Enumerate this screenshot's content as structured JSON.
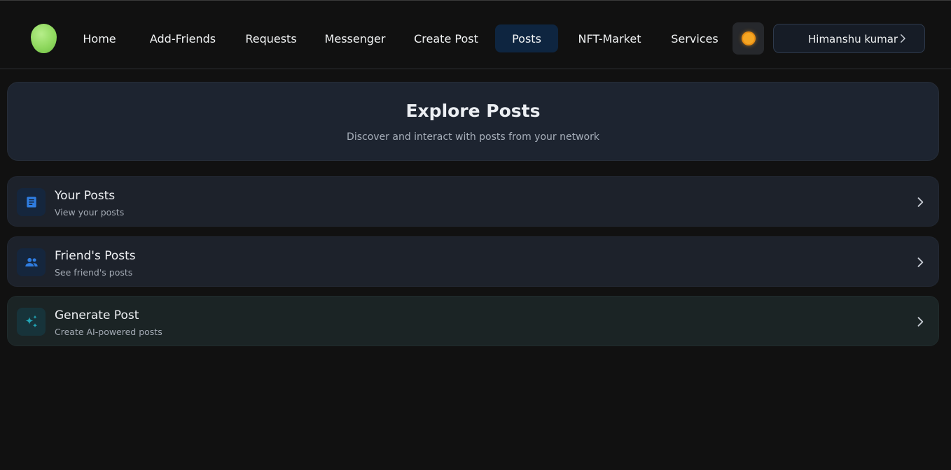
{
  "nav": {
    "items": [
      {
        "label": "Home",
        "active": false
      },
      {
        "label": "Add-Friends",
        "active": false
      },
      {
        "label": "Requests",
        "active": false
      },
      {
        "label": "Messenger",
        "active": false
      },
      {
        "label": "Create Post",
        "active": false
      },
      {
        "label": "Posts",
        "active": true
      },
      {
        "label": "NFT-Market",
        "active": false
      },
      {
        "label": "Services",
        "active": false
      }
    ],
    "theme_icon": "sun-icon",
    "user_name": "Himanshu kumar"
  },
  "hero": {
    "title": "Explore Posts",
    "subtitle": "Discover and interact with posts from your network"
  },
  "cards": [
    {
      "title": "Your Posts",
      "subtitle": "View your posts",
      "icon": "document-icon",
      "icon_color": "#2f7de1"
    },
    {
      "title": "Friend's Posts",
      "subtitle": "See friend's posts",
      "icon": "users-icon",
      "icon_color": "#2f7de1"
    },
    {
      "title": "Generate Post",
      "subtitle": "Create AI-powered posts",
      "icon": "sparkles-icon",
      "icon_color": "#22a7b8"
    }
  ],
  "colors": {
    "background": "#111111",
    "active_tab": "#0e2540",
    "card": "#1d222b",
    "accent_blue": "#2f7de1",
    "accent_teal": "#22a7b8"
  }
}
